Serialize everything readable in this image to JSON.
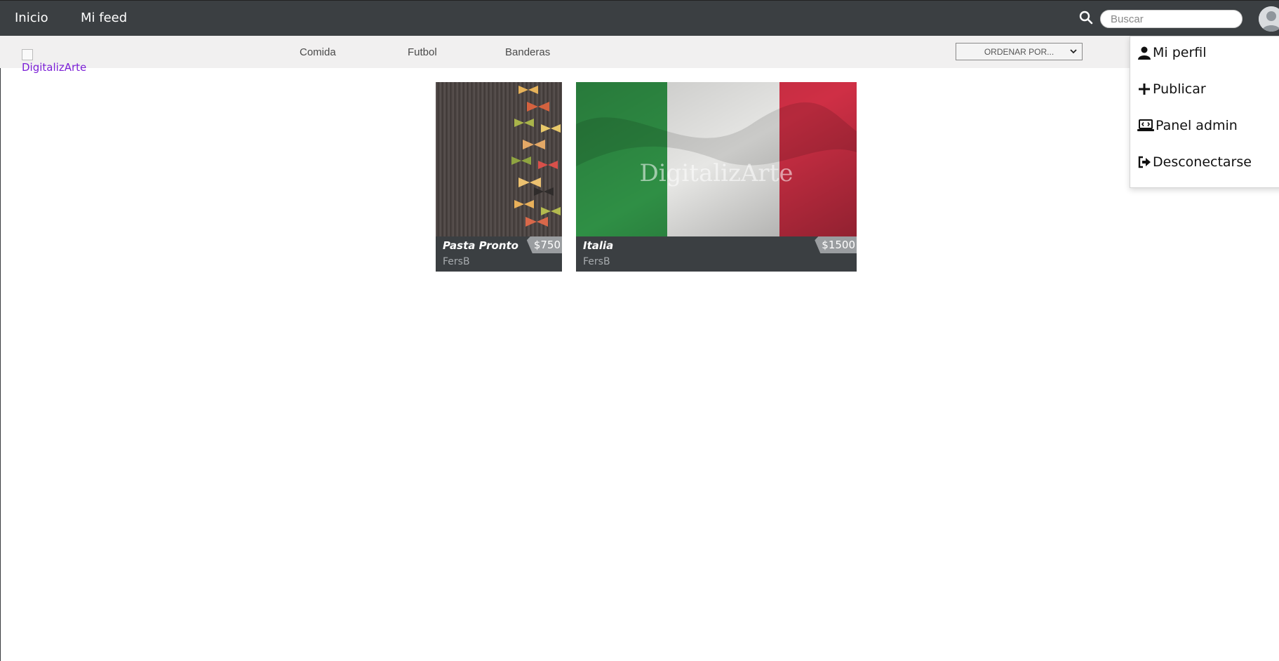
{
  "topnav": {
    "links": [
      "Inicio",
      "Mi feed"
    ],
    "search_placeholder": "Buscar",
    "search_value": ""
  },
  "subnav": {
    "logo_alt": "DigitalizArte",
    "categories": [
      "Comida",
      "Futbol",
      "Banderas"
    ],
    "order_select": "ORDENAR POR..."
  },
  "user_menu": {
    "items": [
      {
        "label": "Mi perfil",
        "icon": "user-icon"
      },
      {
        "label": "Publicar",
        "icon": "plus-icon"
      },
      {
        "label": "Panel admin",
        "icon": "laptop-code-icon"
      },
      {
        "label": "Desconectarse",
        "icon": "sign-out-icon"
      }
    ]
  },
  "cards": [
    {
      "title": "Pasta Pronto",
      "price": "$750",
      "author": "FersB",
      "watermark": ""
    },
    {
      "title": "Italia",
      "price": "$1500",
      "author": "FersB",
      "watermark": "DigitalizArte"
    }
  ],
  "colors": {
    "topnav_bg": "#3b3f42",
    "subnav_bg": "#f1f0f0",
    "logo_link": "#7b1fd6",
    "card_footer": "#3b3f42"
  }
}
